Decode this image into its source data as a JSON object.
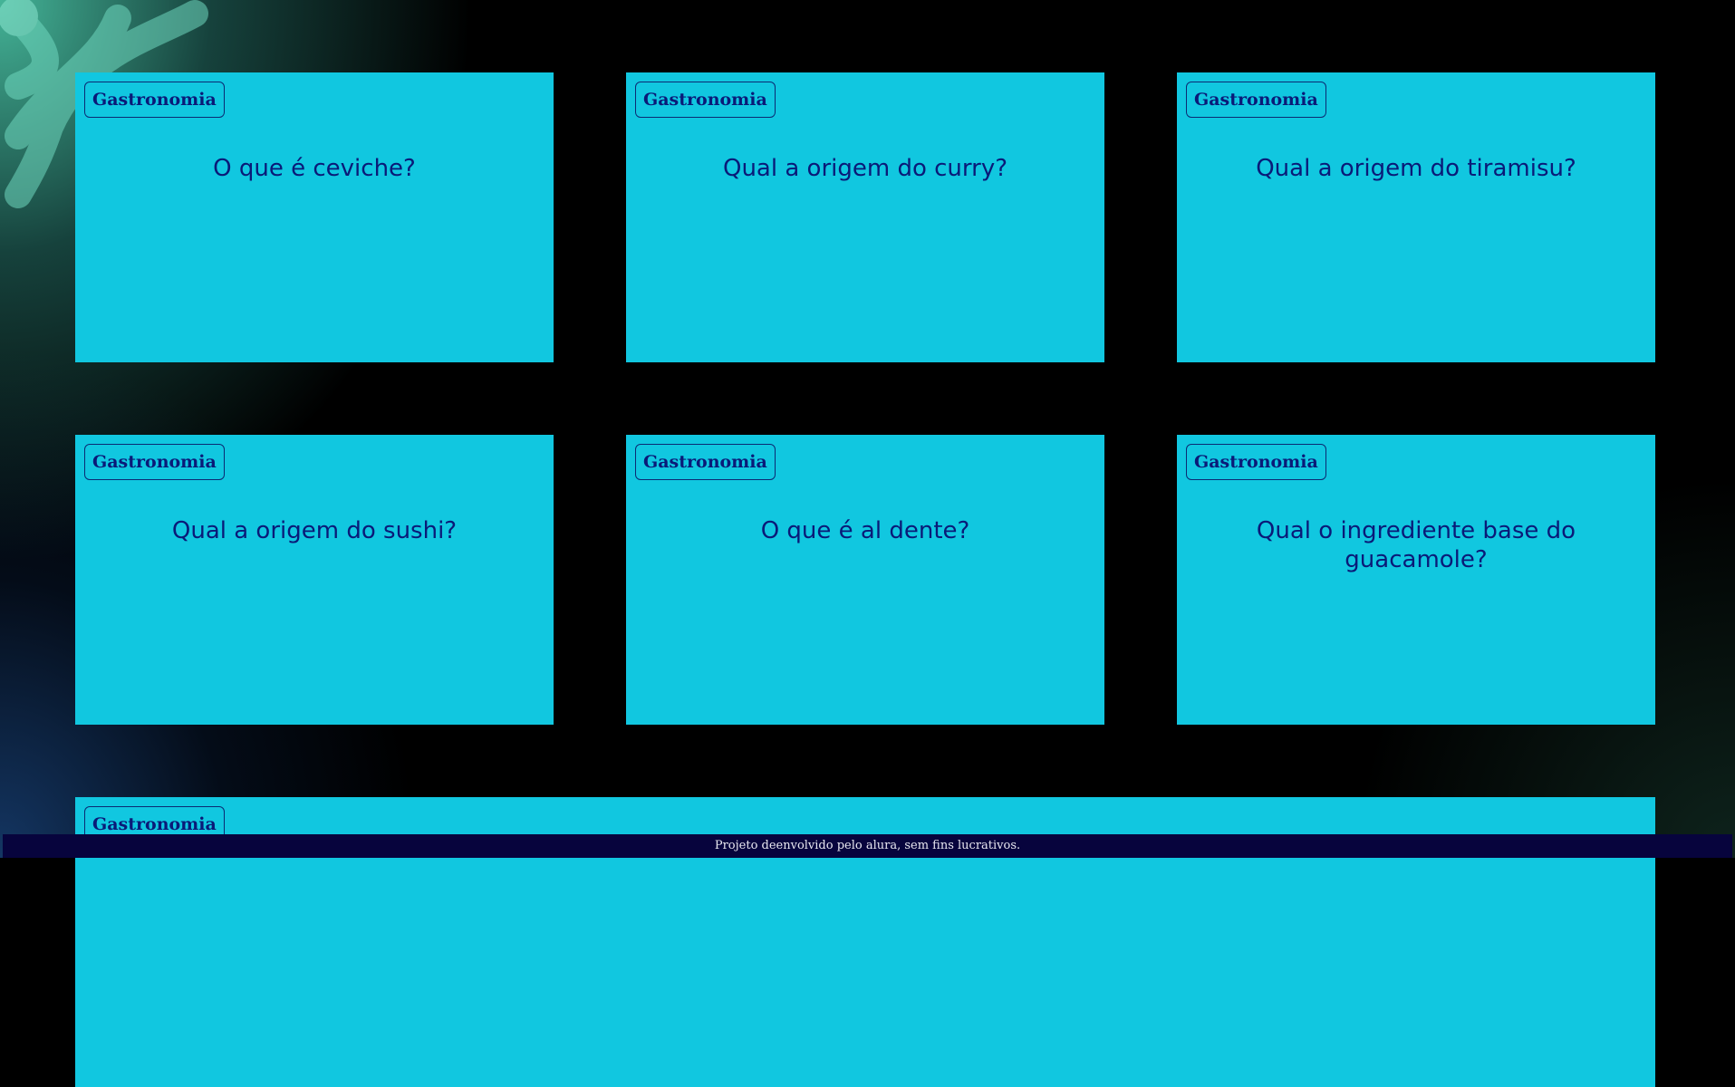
{
  "cards": [
    {
      "category": "Gastronomia",
      "question": "O que é ceviche?"
    },
    {
      "category": "Gastronomia",
      "question": "Qual a origem do curry?"
    },
    {
      "category": "Gastronomia",
      "question": "Qual a origem do tiramisu?"
    },
    {
      "category": "Gastronomia",
      "question": "Qual a origem do sushi?"
    },
    {
      "category": "Gastronomia",
      "question": "O que é al dente?"
    },
    {
      "category": "Gastronomia",
      "question": "Qual o ingrediente base do guacamole?"
    },
    {
      "category": "Gastronomia",
      "question": ""
    }
  ],
  "footer": {
    "text": "Projeto deenvolvido pelo alura, sem fins lucrativos."
  },
  "colors": {
    "card_background": "#11c7e0",
    "text": "#0a1a78",
    "footer_background": "#07043d",
    "page_background": "#000000"
  }
}
